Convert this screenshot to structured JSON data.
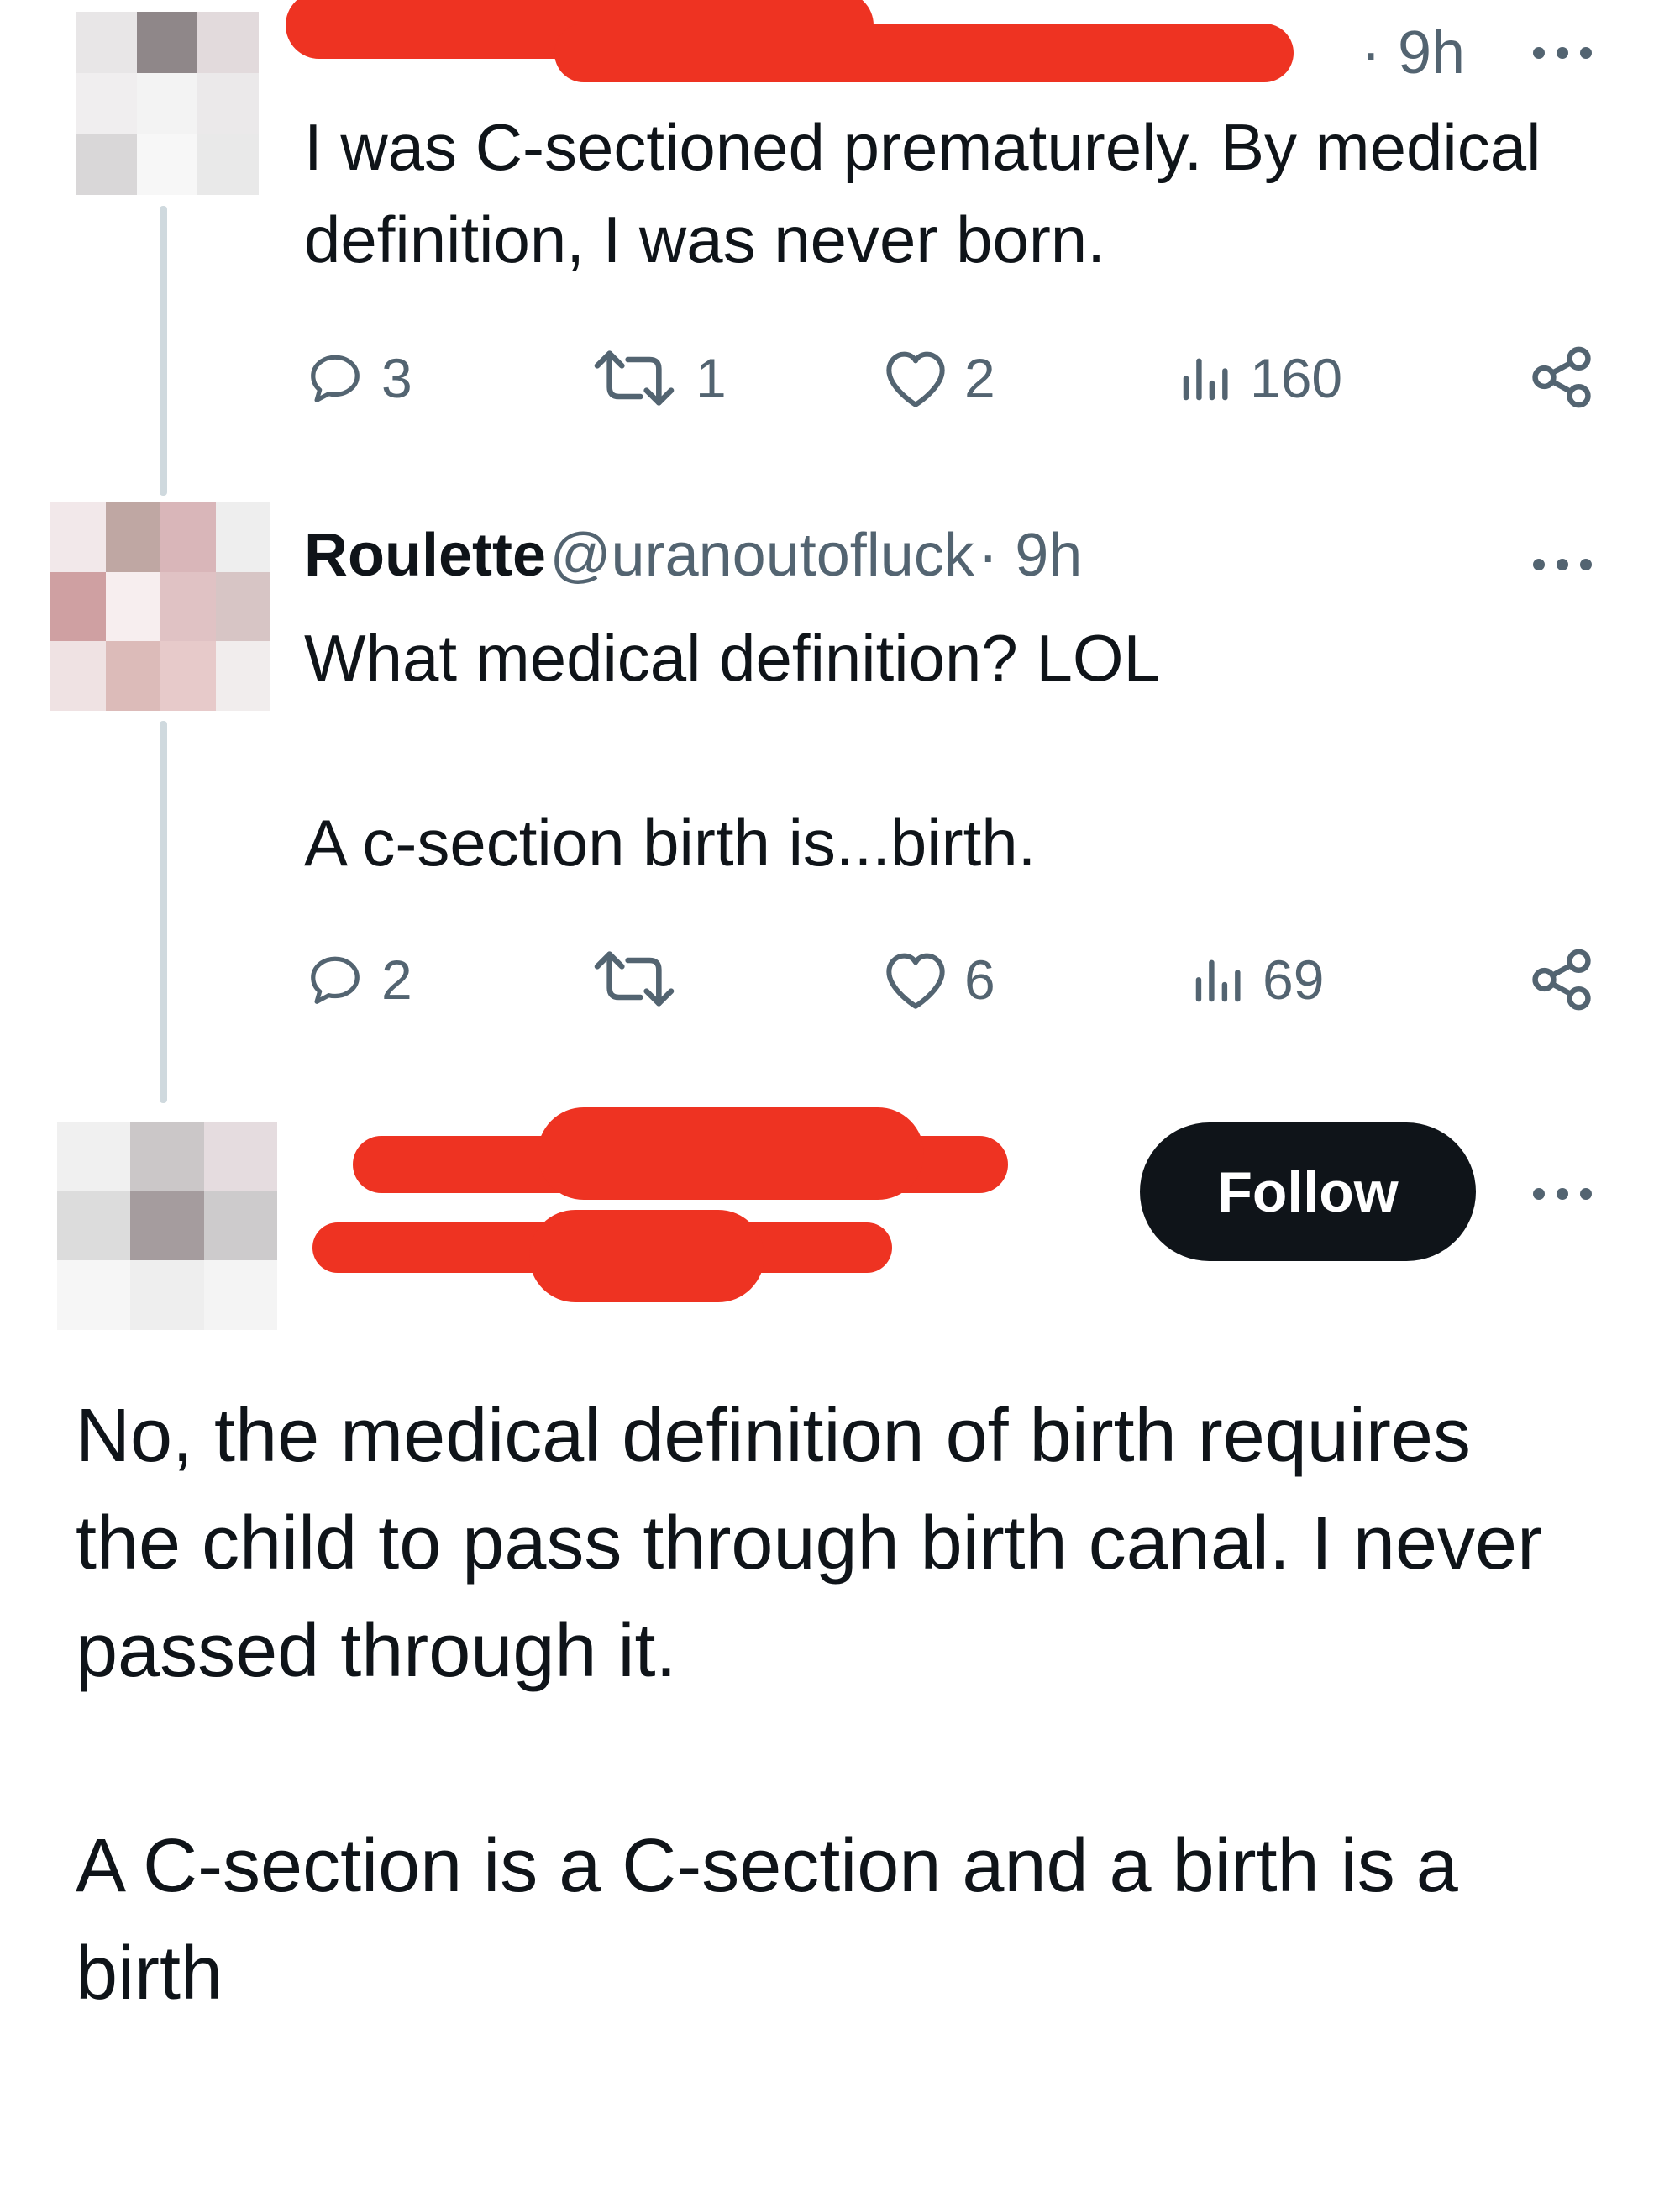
{
  "tweet1": {
    "time": "· 9h",
    "text": "I was C-sectioned prematurely. By medical\ndefinition, I was never born.",
    "stats": {
      "replies": "3",
      "reposts": "1",
      "likes": "2",
      "views": "160"
    }
  },
  "tweet2": {
    "display_name": "Roulette",
    "handle": "@uranoutofluck",
    "time": "· 9h",
    "text": "What medical definition? LOL\n\nA c-section birth is...birth.",
    "stats": {
      "replies": "2",
      "reposts": "",
      "likes": "6",
      "views": "69"
    }
  },
  "tweet3": {
    "follow_label": "Follow",
    "text": "No, the medical definition of birth requires\nthe child to pass through birth canal. I never\npassed through it.\n\nA C-section is a C-section and a birth is a\nbirth"
  },
  "icons": {
    "reply": "reply-icon",
    "repost": "repost-icon",
    "like": "heart-icon",
    "views": "views-icon",
    "share": "share-icon",
    "more": "more-icon"
  },
  "colors": {
    "text": "#0f1419",
    "secondary": "#536471",
    "thread_line": "#cfd9de",
    "redaction": "#ee3322",
    "follow_bg": "#0f1419"
  }
}
